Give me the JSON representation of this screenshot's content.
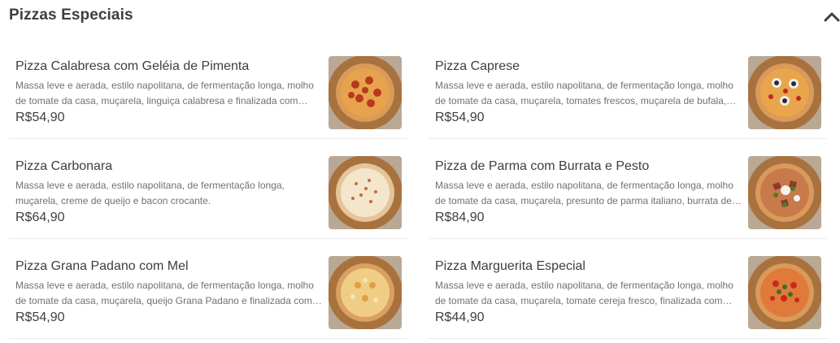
{
  "section": {
    "title": "Pizzas Especiais"
  },
  "items": [
    {
      "name": "Pizza Calabresa com Geléia de Pimenta",
      "description": "Massa leve e aerada, estilo napolitana, de fermentação longa, molho de tomate da casa, muçarela, linguiça calabresa e finalizada com geleia …",
      "price": "R$54,90",
      "image_icon": "pizza-calabresa-image"
    },
    {
      "name": "Pizza Caprese",
      "description": "Massa leve e aerada, estilo napolitana, de fermentação longa, molho de tomate da casa, muçarela, tomates frescos, muçarela de bufala,…",
      "price": "R$54,90",
      "image_icon": "pizza-caprese-image"
    },
    {
      "name": "Pizza Carbonara",
      "description": "Massa leve e aerada, estilo napolitana, de fermentação longa, muçarela, creme de queijo e bacon crocante.",
      "price": "R$64,90",
      "image_icon": "pizza-carbonara-image"
    },
    {
      "name": "Pizza de Parma com Burrata e Pesto",
      "description": "Massa leve e aerada, estilo napolitana, de fermentação longa, molho de tomate da casa, muçarela, presunto de parma italiano, burrata de…",
      "price": "R$84,90",
      "image_icon": "pizza-parma-image"
    },
    {
      "name": "Pizza Grana Padano com Mel",
      "description": "Massa leve e aerada, estilo napolitana, de fermentação longa, molho de tomate da casa, muçarela, queijo Grana Padano e finalizada com mel",
      "price": "R$54,90",
      "image_icon": "pizza-grana-padano-image"
    },
    {
      "name": "Pizza Marguerita Especial",
      "description": "Massa leve e aerada, estilo napolitana, de fermentação longa, molho de tomate da casa, muçarela, tomate cereja fresco, finalizada com…",
      "price": "R$44,90",
      "image_icon": "pizza-marguerita-image"
    }
  ],
  "colors": {
    "text": "#3f3e3e",
    "description": "#717171",
    "divider": "#ebebeb",
    "board": "#a8723f",
    "crust": "#d99a5a"
  }
}
